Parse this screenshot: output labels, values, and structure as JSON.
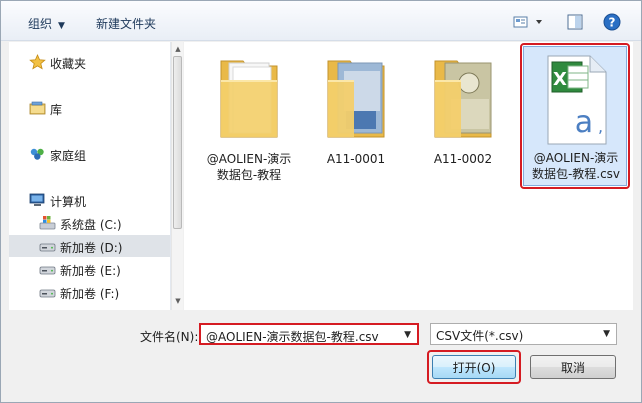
{
  "toolbar": {
    "organize": "组织",
    "new_folder": "新建文件夹"
  },
  "nav": {
    "favorites": "收藏夹",
    "libraries": "库",
    "homegroup": "家庭组",
    "computer": "计算机",
    "drives": [
      {
        "label": "系统盘 (C:)"
      },
      {
        "label": "新加卷 (D:)"
      },
      {
        "label": "新加卷 (E:)"
      },
      {
        "label": "新加卷 (F:)"
      }
    ]
  },
  "files": [
    {
      "line1": "@AOLIEN-演示",
      "line2": "数据包-教程",
      "icon": "folder-icon"
    },
    {
      "line1": "A11-0001",
      "line2": "",
      "icon": "folder-icon"
    },
    {
      "line1": "A11-0002",
      "line2": "",
      "icon": "folder-icon"
    },
    {
      "line1": "@AOLIEN-演示",
      "line2": "数据包-教程.csv",
      "icon": "excel-csv-icon"
    }
  ],
  "bottom": {
    "filename_label": "文件名(N):",
    "filename_value": "@AOLIEN-演示数据包-教程.csv",
    "filetype_value": "CSV文件(*.csv)",
    "open_label": "打开(O)",
    "cancel_label": "取消"
  },
  "colors": {
    "highlight_red": "#d51b22",
    "selection_blue": "#d6e7fb",
    "folder_yellow": "#f3cf6b"
  }
}
